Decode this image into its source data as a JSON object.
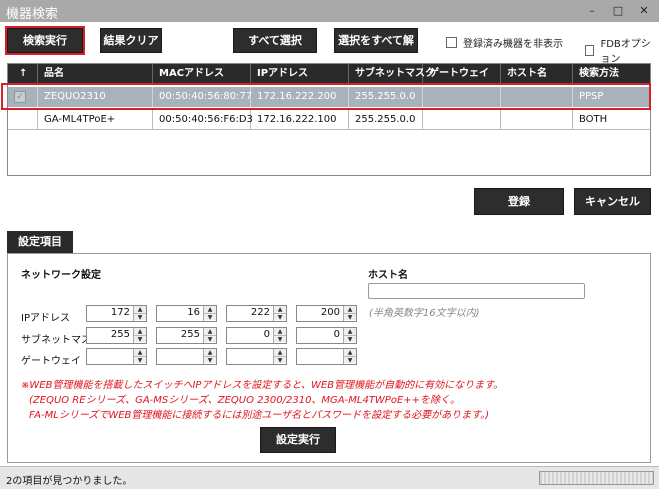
{
  "window": {
    "title": "機器検索",
    "min_glyph": "–",
    "max_glyph": "□",
    "close_glyph": "✕"
  },
  "toolbar": {
    "search_label": "検索実行",
    "clear_label": "結果クリア",
    "select_all_label": "すべて選択",
    "deselect_all_label": "選択をすべて解除",
    "hide_registered_label": "登録済み機器を非表示",
    "fdb_option_label": "FDBオプション"
  },
  "table": {
    "sort_glyph": "↑",
    "columns": [
      "品名",
      "MACアドレス",
      "IPアドレス",
      "サブネットマスク",
      "ゲートウェイ",
      "ホスト名",
      "検索方法"
    ],
    "rows": [
      {
        "checked": true,
        "selected": true,
        "cells": [
          "ZEQUO2310",
          "00:50:40:56:80:77",
          "172.16.222.200",
          "255.255.0.0",
          "",
          "",
          "PPSP"
        ]
      },
      {
        "checked": false,
        "selected": false,
        "cells": [
          "GA-ML4TPoE+",
          "00:50:40:56:F6:D3",
          "172.16.222.100",
          "255.255.0.0",
          "",
          "",
          "BOTH"
        ]
      }
    ]
  },
  "actions": {
    "register_label": "登録",
    "cancel_label": "キャンセル"
  },
  "settings": {
    "tab_label": "設定項目",
    "network_heading": "ネットワーク設定",
    "ip_label": "IPアドレス",
    "subnet_label": "サブネットマスク",
    "gateway_label": "ゲートウェイ",
    "ip": [
      "172",
      "16",
      "222",
      "200"
    ],
    "subnet": [
      "255",
      "255",
      "0",
      "0"
    ],
    "gateway": [
      "",
      "",
      "",
      ""
    ],
    "hostname_heading": "ホスト名",
    "hostname_value": "",
    "hostname_hint": "(半角英数字16文字以内)",
    "note_line1": "※WEB管理機能を搭載したスイッチへIPアドレスを設定すると、WEB管理機能が自動的に有効になります。",
    "note_line2": "(ZEQUO REシリーズ、GA-MSシリーズ、ZEQUO 2300/2310、MGA-ML4TWPoE++を除く。",
    "note_line3": "FA-MLシリーズでWEB管理機能に接続するには別途ユーザ名とパスワードを設定する必要があります。)",
    "apply_label": "設定実行"
  },
  "status": {
    "message": "2の項目が見つかりました。"
  }
}
